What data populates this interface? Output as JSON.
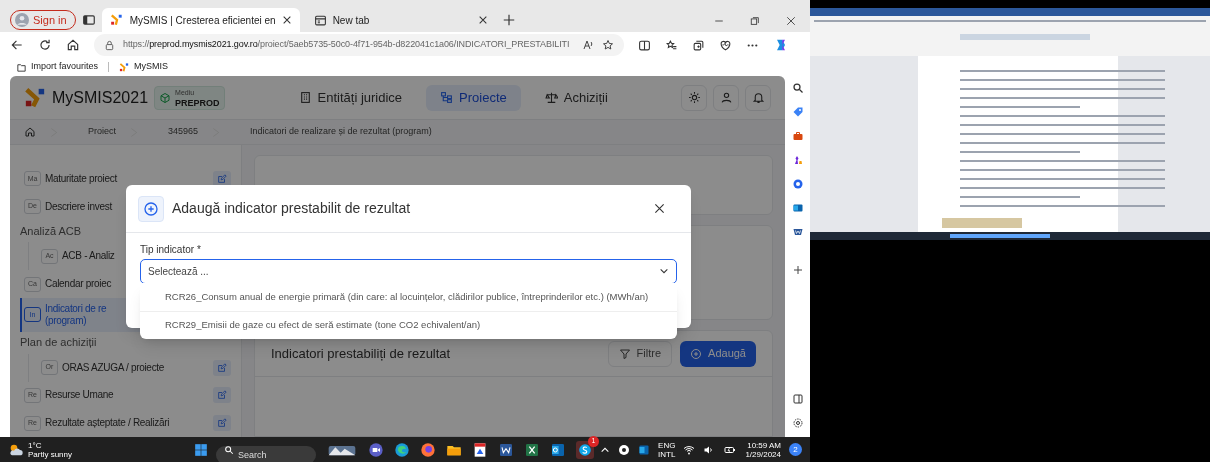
{
  "browser": {
    "profile_button": "Sign in",
    "tabs": [
      {
        "title": "MySMIS | Cresterea eficientei en",
        "selected": true
      },
      {
        "title": "New tab",
        "selected": false
      }
    ],
    "address": {
      "scheme": "https://",
      "host": "preprod.mysmis2021.gov.ro",
      "path": "/proiect/5aeb5735-50c0-4f71-954b-d822041c1a06/INDICATORI_PRESTABILITI"
    },
    "favorites": [
      "Import favourites",
      "MySMIS"
    ]
  },
  "app": {
    "name": "MySMIS2021",
    "env_label": "Mediu",
    "env": "PREPROD",
    "nav": [
      {
        "label": "Entități juridice",
        "selected": false
      },
      {
        "label": "Proiecte",
        "selected": true
      },
      {
        "label": "Achiziții",
        "selected": false
      }
    ],
    "breadcrumb": [
      "Proiect",
      "345965",
      "Indicatori de realizare și de rezultat (program)"
    ]
  },
  "sidebar": {
    "items": [
      {
        "kind": "item",
        "badge": "Ma",
        "lines": [
          "Maturitate proiect"
        ],
        "editable": true,
        "selected": false
      },
      {
        "kind": "item",
        "badge": "De",
        "lines": [
          "Descriere invest"
        ],
        "selected": false
      },
      {
        "kind": "section",
        "label": "Analiză ACB",
        "children": [
          {
            "badge": "Ac",
            "lines": [
              "ACB - Analiz"
            ],
            "selected": false
          }
        ]
      },
      {
        "kind": "item",
        "badge": "Ca",
        "lines": [
          "Calendar proiec"
        ],
        "selected": false
      },
      {
        "kind": "item",
        "badge": "In",
        "lines": [
          "Indicatori de re",
          "(program)"
        ],
        "selected": true
      },
      {
        "kind": "section",
        "label": "Plan de achiziții",
        "children": [
          {
            "badge": "Or",
            "lines": [
              "ORAS AZUGA / proiecte"
            ],
            "editable": true,
            "selected": false
          }
        ]
      },
      {
        "kind": "item",
        "badge": "Re",
        "lines": [
          "Resurse Umane"
        ],
        "editable": true,
        "selected": false
      },
      {
        "kind": "item",
        "badge": "Re",
        "lines": [
          "Rezultate așteptate / Realizări"
        ],
        "editable": true,
        "selected": false
      }
    ]
  },
  "main": {
    "section_title": "Indicatori prestabiliți de rezultat",
    "filter_button": "Filtre",
    "add_button": "Adaugă"
  },
  "modal": {
    "title": "Adaugă indicator prestabilit de rezultat",
    "field_label": "Tip indicator *",
    "placeholder": "Selectează ...",
    "expanded": true,
    "options": [
      "RCR26_Consum anual de energie primară (din care: al locuințelor, clădirilor publice, întreprinderilor etc.) (MWh/an)",
      "RCR29_Emisii de gaze cu efect de seră estimate (tone CO2 echivalent/an)"
    ]
  },
  "taskbar": {
    "temperature": "1°C",
    "weather": "Partly sunny",
    "search_placeholder": "Search",
    "chat_badge": "1",
    "language": "ENG",
    "layout": "INTL",
    "time": "10:59 AM",
    "date": "1/29/2024",
    "notifications": "2"
  }
}
